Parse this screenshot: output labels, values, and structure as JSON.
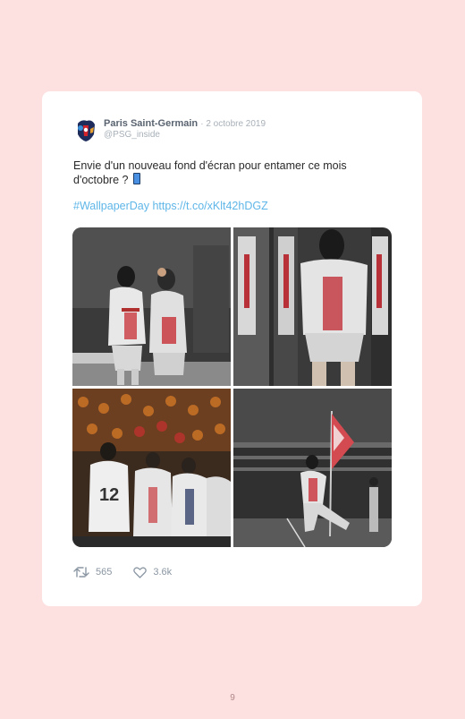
{
  "tweet": {
    "author_name": "Paris Saint-Germain",
    "date": "· 2 octobre 2019",
    "handle": "@PSG_inside",
    "text_line": "Envie d'un nouveau fond d'écran pour entamer ce mois d'octobre ?",
    "hashtag": "#WallpaperDay",
    "link": "https://t.co/xKlt42hDGZ",
    "retweet_count": "565",
    "like_count": "3.6k",
    "icons": {
      "avatar": "psg-crest-icon",
      "emoji": "mobile-phone-icon",
      "retweet": "retweet-icon",
      "like": "heart-icon"
    }
  },
  "page": {
    "number": "9"
  },
  "colors": {
    "background": "#fde0e0",
    "card": "#ffffff",
    "link": "#5fb6e8",
    "psg_red": "#d3222a",
    "psg_navy": "#1d2c5a"
  }
}
